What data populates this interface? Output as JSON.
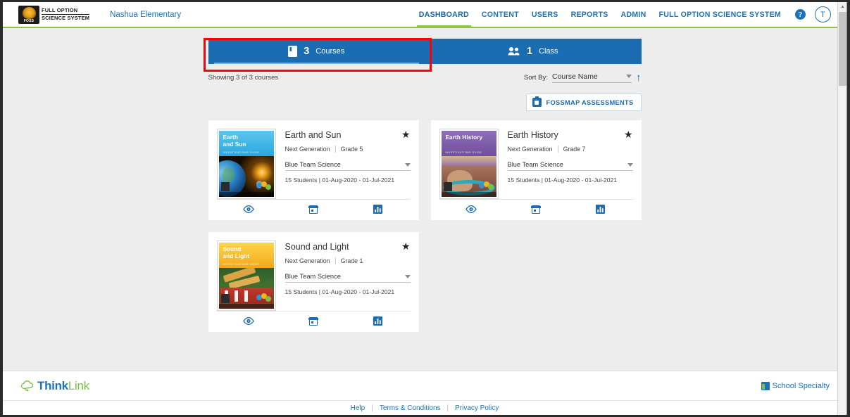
{
  "header": {
    "logo_alt": "FOSS Full Option Science System",
    "logo_line1": "FULL OPTION",
    "logo_line2": "SCIENCE SYSTEM",
    "logo_mark_text": "FOSS",
    "school_name": "Nashua Elementary",
    "nav": [
      {
        "label": "DASHBOARD",
        "active": true
      },
      {
        "label": "CONTENT",
        "active": false
      },
      {
        "label": "USERS",
        "active": false
      },
      {
        "label": "REPORTS",
        "active": false
      },
      {
        "label": "ADMIN",
        "active": false
      },
      {
        "label": "FULL OPTION SCIENCE SYSTEM",
        "active": false
      }
    ],
    "help_label": "?",
    "avatar_initial": "T"
  },
  "tabs": [
    {
      "count": "3",
      "label": "Courses",
      "icon": "book-icon",
      "active": true
    },
    {
      "count": "1",
      "label": "Class",
      "icon": "people-icon",
      "active": false
    }
  ],
  "toolbar": {
    "showing_text": "Showing 3 of 3 courses",
    "sort_label": "Sort By:",
    "sort_value": "Course Name",
    "sort_direction": "↑",
    "assessments_label": "FOSSMAP ASSESSMENTS"
  },
  "courses": [
    {
      "title": "Earth and Sun",
      "standard": "Next Generation",
      "grade": "Grade 5",
      "class_name": "Blue Team Science",
      "students": "15 Students",
      "date_range": "01-Aug-2020 - 01-Jul-2021",
      "cover_title": "Earth\nand Sun",
      "cover_subtitle": "INVESTIGATIONS GUIDE",
      "favorite": true
    },
    {
      "title": "Earth History",
      "standard": "Next Generation",
      "grade": "Grade 7",
      "class_name": "Blue Team Science",
      "students": "15 Students",
      "date_range": "01-Aug-2020 - 01-Jul-2021",
      "cover_title": "Earth History",
      "cover_subtitle": "INVESTIGATIONS GUIDE",
      "favorite": true
    },
    {
      "title": "Sound and Light",
      "standard": "Next Generation",
      "grade": "Grade 1",
      "class_name": "Blue Team Science",
      "students": "15 Students",
      "date_range": "01-Aug-2020 - 01-Jul-2021",
      "cover_title": "Sound\nand Light",
      "cover_subtitle": "INVESTIGATIONS GUIDE",
      "favorite": true
    }
  ],
  "card_actions": {
    "view_icon": "eye-icon",
    "calendar_icon": "calendar-icon",
    "report_icon": "bar-chart-icon"
  },
  "separators": {
    "pipe": "|",
    "students_sep": "|"
  },
  "footer": {
    "thinklink_think": "Think",
    "thinklink_link": "Link",
    "school_specialty": "School Specialty",
    "links": [
      "Help",
      "Terms & Conditions",
      "Privacy Policy"
    ],
    "link_divider": "|"
  },
  "colors": {
    "tab_blue": "#1b6cb0",
    "link_blue": "#1b72b8",
    "accent_green": "#8dc63f",
    "annotation_red": "#ff0000",
    "page_bg": "#ededed"
  }
}
